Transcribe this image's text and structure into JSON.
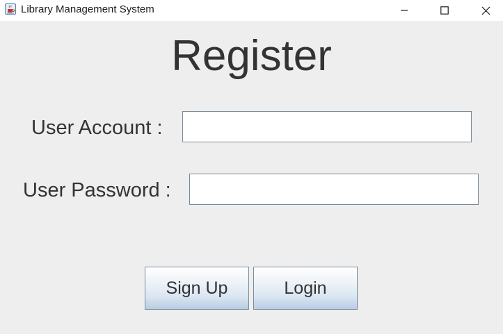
{
  "window": {
    "title": "Library Management System",
    "app_icon": "java-cup-icon",
    "controls": {
      "minimize_icon": "minimize-icon",
      "maximize_icon": "maximize-icon",
      "close_icon": "close-icon"
    }
  },
  "form": {
    "heading": "Register",
    "account": {
      "label": "User Account :",
      "value": "",
      "placeholder": ""
    },
    "password": {
      "label": "User Password :",
      "value": "",
      "placeholder": ""
    }
  },
  "actions": {
    "signup_label": "Sign Up",
    "login_label": "Login"
  },
  "colors": {
    "background": "#eeeeee",
    "text": "#333333",
    "button_gradient_bottom": "#b8cde3",
    "border": "#7a8a99"
  }
}
